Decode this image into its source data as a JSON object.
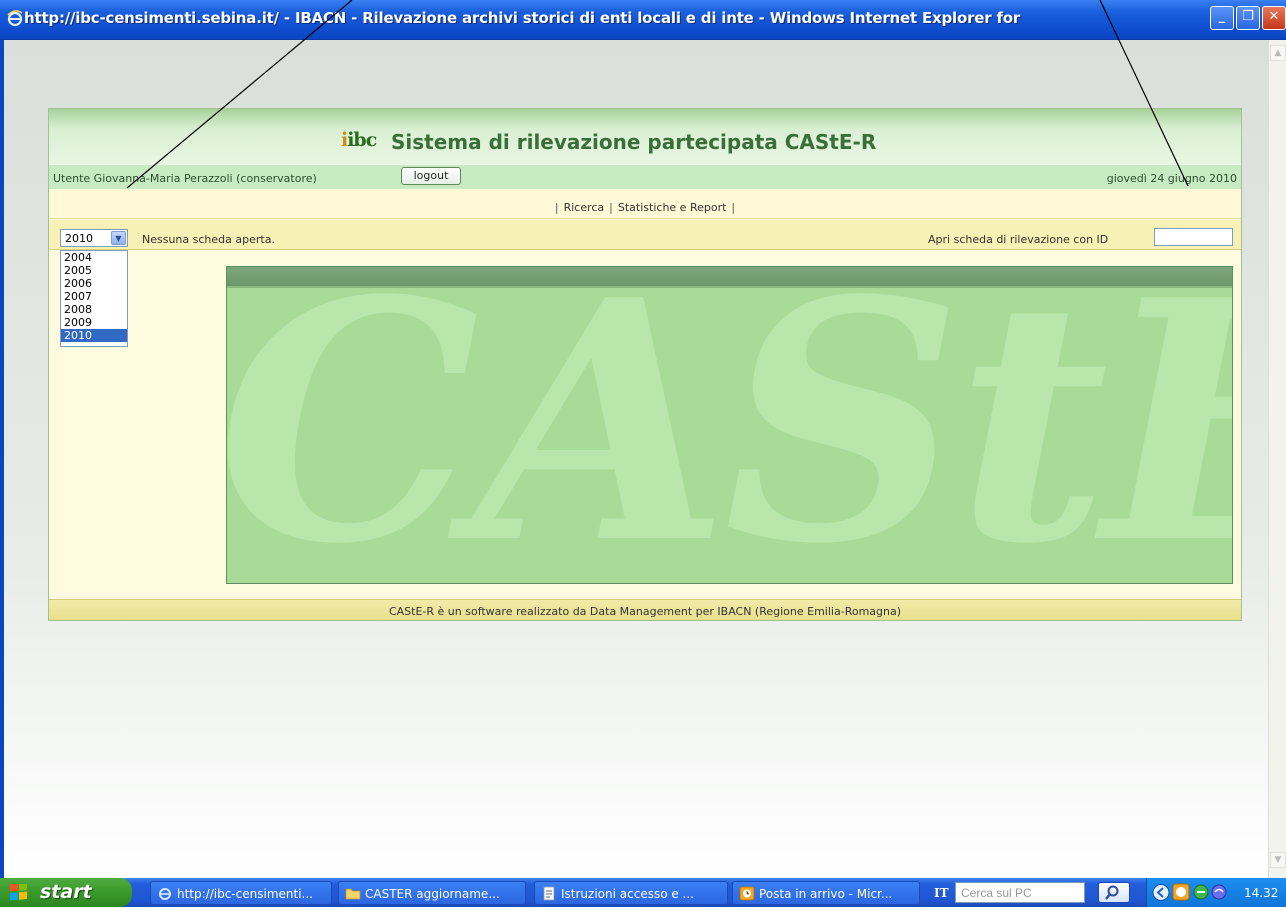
{
  "window": {
    "title": "http://ibc-censimenti.sebina.it/ - IBACN - Rilevazione archivi storici di enti locali e di inte - Windows Internet Explorer for"
  },
  "app": {
    "logo": "ibc",
    "title": "Sistema di rilevazione partecipata CAStE-R",
    "user": "Utente Giovanna-Maria Perazzoli (conservatore)",
    "logout_label": "logout",
    "date": "giovedì 24 giugno 2010",
    "menu": {
      "sep_left": "|",
      "ricerca": "Ricerca",
      "sep_mid": "|",
      "statistiche": "Statistiche e Report",
      "sep_right": "|"
    },
    "year_selected": "2010",
    "year_options": [
      "2004",
      "2005",
      "2006",
      "2007",
      "2008",
      "2009",
      "2010"
    ],
    "no_sheet": "Nessuna scheda aperta.",
    "open_label": "Apri scheda di rilevazione con ID",
    "id_value": "",
    "watermark": "CAStER",
    "footer": "CAStE-R è un software realizzato da Data Management per IBACN (Regione Emilia-Romagna)"
  },
  "taskbar": {
    "start": "start",
    "tasks": [
      {
        "label": "http://ibc-censimenti...",
        "icon": "ie-icon"
      },
      {
        "label": "CASTER aggiorname...",
        "icon": "folder-icon"
      },
      {
        "label": "Istruzioni accesso e ...",
        "icon": "document-icon"
      },
      {
        "label": "Posta in arrivo - Micr...",
        "icon": "outlook-icon"
      }
    ],
    "language": "IT",
    "search_placeholder": "Cerca sul PC",
    "clock": "14.32"
  }
}
